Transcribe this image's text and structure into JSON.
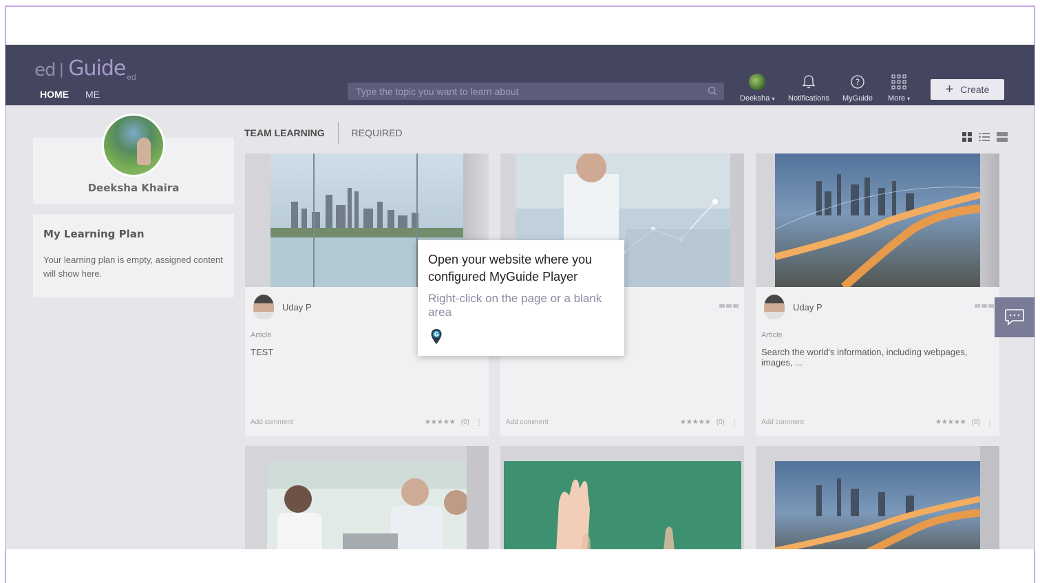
{
  "header": {
    "logo": {
      "ed": "ed",
      "separator": "|",
      "guide": "Guide",
      "sub": "ed"
    },
    "nav": [
      {
        "label": "HOME",
        "active": true
      },
      {
        "label": "ME",
        "active": false
      }
    ],
    "search": {
      "placeholder": "Type the topic you want to learn about",
      "value": ""
    },
    "user_menu": {
      "label": "Deeksha",
      "caret": "▾"
    },
    "notifications_label": "Notifications",
    "myguide_label": "MyGuide",
    "more_label": "More",
    "more_caret": "▾",
    "create_label": "Create",
    "create_icon": "+"
  },
  "profile": {
    "name": "Deeksha Khaira"
  },
  "learning_plan": {
    "title": "My Learning Plan",
    "text": "Your learning plan is empty, assigned content will show here."
  },
  "tabs": [
    {
      "label": "TEAM LEARNING",
      "active": true
    },
    {
      "label": "REQUIRED",
      "active": false
    }
  ],
  "cards": [
    {
      "author": "Uday P",
      "type": "Article",
      "title": "TEST",
      "add_comment": "Add comment",
      "stars": "★★★★★",
      "count": "(0)",
      "more": "⋮"
    },
    {
      "author": "",
      "type": "",
      "title": "",
      "add_comment": "Add comment",
      "stars": "★★★★★",
      "count": "(0)",
      "more": "⋮"
    },
    {
      "author": "Uday P",
      "type": "Article",
      "title": "Search the world's information, including webpages, images, ...",
      "add_comment": "Add comment",
      "stars": "★★★★★",
      "count": "(0)",
      "more": "⋮"
    }
  ],
  "tooltip": {
    "title": "Open your website where you configured MyGuide Player",
    "description": "Right-click on the page or a blank area"
  },
  "colors": {
    "header_bg": "#44455f",
    "page_bg": "#e3e3e7",
    "card_bg": "#efeff2",
    "accent_border": "#c9a8e8"
  }
}
